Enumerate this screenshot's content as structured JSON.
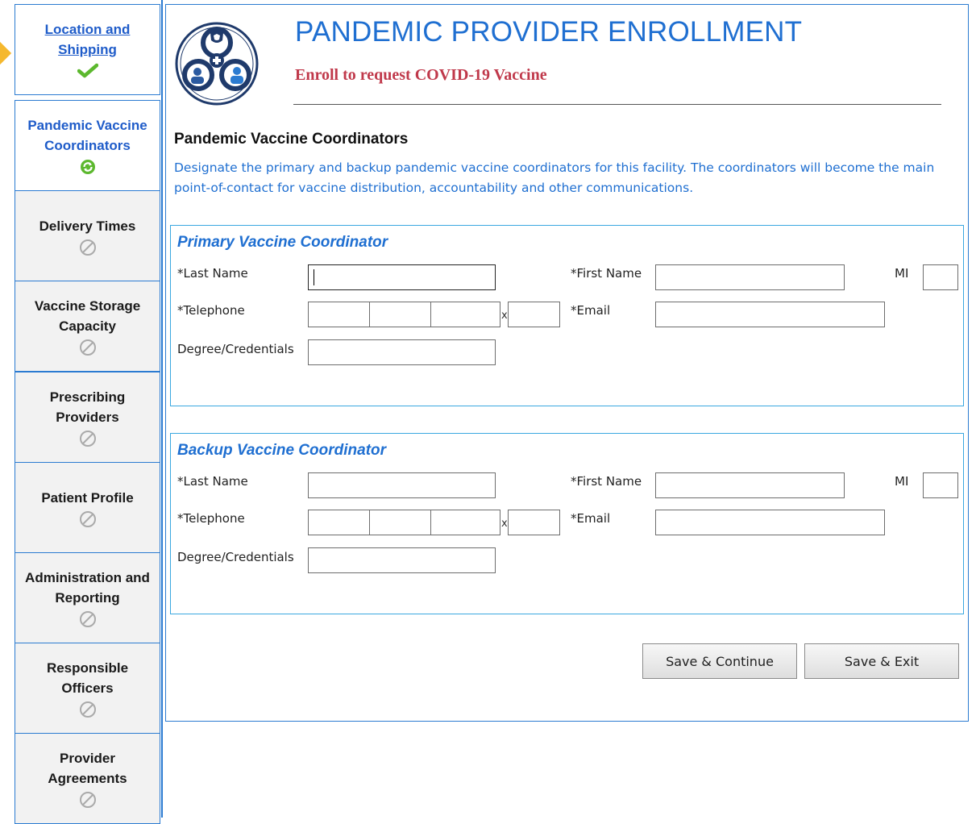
{
  "sidebar": {
    "items": [
      {
        "label_line1": "Location and",
        "label_line2": "Shipping",
        "icon": "checkmark-icon",
        "state": "complete"
      },
      {
        "label_line1": "Pandemic Vaccine",
        "label_line2": "Coordinators",
        "icon": "refresh-icon",
        "state": "current"
      },
      {
        "label_line1": "Delivery Times",
        "label_line2": "",
        "icon": "disabled-icon",
        "state": "locked"
      },
      {
        "label_line1": "Vaccine Storage",
        "label_line2": "Capacity",
        "icon": "disabled-icon",
        "state": "locked"
      },
      {
        "label_line1": "Prescribing",
        "label_line2": "Providers",
        "icon": "disabled-icon",
        "state": "locked"
      },
      {
        "label_line1": "Patient Profile",
        "label_line2": "",
        "icon": "disabled-icon",
        "state": "locked"
      },
      {
        "label_line1": "Administration and",
        "label_line2": "Reporting",
        "icon": "disabled-icon",
        "state": "locked"
      },
      {
        "label_line1": "Responsible",
        "label_line2": "Officers",
        "icon": "disabled-icon",
        "state": "locked"
      },
      {
        "label_line1": "Provider",
        "label_line2": "Agreements",
        "icon": "disabled-icon",
        "state": "locked"
      }
    ]
  },
  "header": {
    "title": "PANDEMIC PROVIDER ENROLLMENT",
    "subtitle": "Enroll to request COVID-19 Vaccine"
  },
  "section": {
    "heading": "Pandemic Vaccine Coordinators",
    "description": "Designate the primary and backup pandemic vaccine coordinators for this facility. The coordinators will become the main point-of-contact for vaccine distribution, accountability and other communications."
  },
  "primary": {
    "title": "Primary Vaccine Coordinator",
    "last_name_label": "*Last Name",
    "first_name_label": "*First Name",
    "mi_label": "MI",
    "telephone_label": "*Telephone",
    "ext_sep": "x",
    "email_label": "*Email",
    "degree_label": "Degree/Credentials",
    "last_name": "",
    "first_name": "",
    "mi": "",
    "phone_area": "",
    "phone_prefix": "",
    "phone_line": "",
    "phone_ext": "",
    "email": "",
    "degree": ""
  },
  "backup": {
    "title": "Backup Vaccine Coordinator",
    "last_name_label": "*Last Name",
    "first_name_label": "*First Name",
    "mi_label": "MI",
    "telephone_label": "*Telephone",
    "ext_sep": "x",
    "email_label": "*Email",
    "degree_label": "Degree/Credentials",
    "last_name": "",
    "first_name": "",
    "mi": "",
    "phone_area": "",
    "phone_prefix": "",
    "phone_line": "",
    "phone_ext": "",
    "email": "",
    "degree": ""
  },
  "actions": {
    "save_continue": "Save & Continue",
    "save_exit": "Save & Exit"
  },
  "colors": {
    "accent_blue": "#1f6fd1",
    "subtitle_red": "#c0394b",
    "complete_green": "#5cb82e",
    "pointer_gold": "#f5b82e"
  }
}
